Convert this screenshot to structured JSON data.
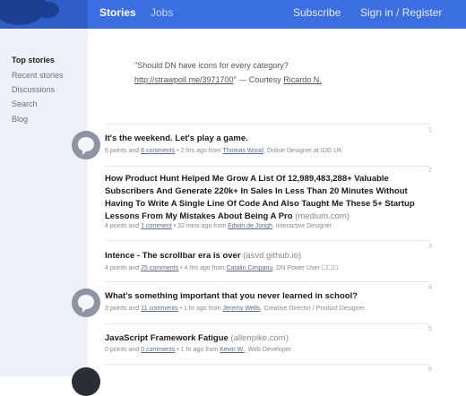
{
  "nav": {
    "stories": "Stories",
    "jobs": "Jobs",
    "subscribe": "Subscribe",
    "signin": "Sign in / Register"
  },
  "sidebar": {
    "items": [
      {
        "label": "Top stories",
        "active": true
      },
      {
        "label": "Recent stories"
      },
      {
        "label": "Discussions"
      },
      {
        "label": "Search"
      },
      {
        "label": "Blog"
      }
    ]
  },
  "pinned": {
    "quote": "\"Should DN have icons for every category?",
    "link": "http://strawpoll.me/3971700",
    "courtesy": "\" — Courtesy ",
    "author": "Ricardo N."
  },
  "stories": [
    {
      "rank": "1",
      "title": "It's the weekend. Let's play a game.",
      "source": "",
      "points": "6 points and",
      "comments": "6 comments",
      "time": "• 2 hrs ago from",
      "user": "Thomas Wood",
      "role": ", Online Designer at IDG UK"
    },
    {
      "rank": "2",
      "title": "How Product Hunt Helped Me Grow A List Of 12,989,483,288+ Valuable Subscribers And Generate 220k+ In Sales In Less Than 20 Minutes Without Having To Write A Single Line Of Code And Also Taught Me These 5+ Startup Lessons From My Mistakes About Being A Pro",
      "source": "(medium.com)",
      "points": "4 points and",
      "comments": "1 comment",
      "time": "• 32 mins ago from",
      "user": "Edwin de Jongh",
      "role": ", Interactive Designer"
    },
    {
      "rank": "3",
      "title": "Intence - The scrollbar era is over",
      "source": "(asvd.github.io)",
      "points": "4 points and",
      "comments": "25 comments",
      "time": "• 4 hrs ago from",
      "user": "Catalin Cimpanu",
      "role": ", DN Power User ☐☐☐"
    },
    {
      "rank": "4",
      "title": "What's something important that you never learned in school?",
      "source": "",
      "points": "3 points and",
      "comments": "11 comments",
      "time": "• 1 hr ago from",
      "user": "Jeremy Wells",
      "role": ", Creative Director / Product Designer"
    },
    {
      "rank": "5",
      "title": "JavaScript Framework Fatigue",
      "source": "(allenpike.com)",
      "points": "0 points and",
      "comments": "0 comments",
      "time": "• 1 hr ago from",
      "user": "Kevin W.",
      "role": ", Web Developer"
    }
  ]
}
